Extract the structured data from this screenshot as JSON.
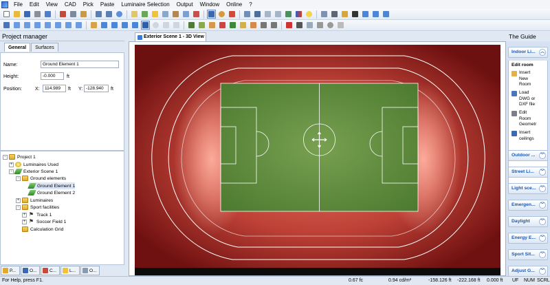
{
  "menu": {
    "items": [
      "File",
      "Edit",
      "View",
      "CAD",
      "Pick",
      "Paste",
      "Luminaire Selection",
      "Output",
      "Window",
      "Online",
      "?"
    ],
    "underline": [
      "F",
      "E",
      "V",
      "C",
      "P",
      "a",
      "L",
      "O",
      "W",
      "O",
      "?"
    ]
  },
  "project_manager": {
    "title": "Project manager",
    "tabs": [
      "General",
      "Surfaces"
    ],
    "active_tab": "General",
    "name_label": "Name:",
    "name_value": "Ground Element 1",
    "height_label": "Height:",
    "height_value": "-0.000",
    "height_unit": "ft",
    "position_label": "Position:",
    "x_label": "X:",
    "x_value": "114.989",
    "x_unit": "ft",
    "y_label": "Y:",
    "y_value": "-128.940",
    "y_unit": "ft"
  },
  "tree": [
    {
      "label": "Project 1",
      "expander": "-",
      "icon": "folder-icon"
    },
    {
      "label": "Luminaires Used",
      "expander": "+",
      "icon": "luminaire-icon"
    },
    {
      "label": "Exterior Scene 1",
      "expander": "-",
      "icon": "scene-icon"
    },
    {
      "label": "Ground elements",
      "expander": "-",
      "icon": "folder-icon"
    },
    {
      "label": "Ground Element 1",
      "expander": "",
      "icon": "ground-element-icon"
    },
    {
      "label": "Ground Element 2",
      "expander": "",
      "icon": "ground-element-icon"
    },
    {
      "label": "Luminaires",
      "expander": "+",
      "icon": "folder-icon"
    },
    {
      "label": "Sport facilities",
      "expander": "-",
      "icon": "folder-icon"
    },
    {
      "label": "Track 1",
      "expander": "+",
      "icon": "track-icon"
    },
    {
      "label": "Soccer Field 1",
      "expander": "+",
      "icon": "soccer-field-icon"
    },
    {
      "label": "Calculation Grid",
      "expander": "",
      "icon": "folder-icon"
    }
  ],
  "bottom_tabs": [
    "P...",
    "O...",
    "C...",
    "L...",
    "O..."
  ],
  "document_tab": "Exterior Scene 1 - 3D View",
  "guide": {
    "title": "The Guide",
    "active_section": "Indoor Li...",
    "body_heading": "Edit room",
    "body_items": [
      {
        "label": "Insert New Room",
        "icon": "insert-room-icon"
      },
      {
        "label": "Load DWG or DXF file",
        "icon": "load-dwg-icon"
      },
      {
        "label": "Edit Room Geometr",
        "icon": "edit-room-icon"
      },
      {
        "label": "Insert ceilings",
        "icon": "insert-ceilings-icon"
      }
    ],
    "sections": [
      "Outdoor ...",
      "Street Li...",
      "Light sce...",
      "Emergen...",
      "Daylight",
      "Energy E...",
      "Sport Sit...",
      "Adjust G..."
    ]
  },
  "status": {
    "help": "For Help, press F1.",
    "value1": "0.67 fc",
    "value2": "0.94 cd/m²",
    "x": "-158.126 ft",
    "y": "-222.168 ft",
    "z": "0.000 ft",
    "uf": "UF",
    "num": "NUM",
    "scrl": "SCRL"
  },
  "colors": {
    "accent": "#1b56b3",
    "field_green": "#5f8a3c",
    "track_red": "#a3231c"
  }
}
